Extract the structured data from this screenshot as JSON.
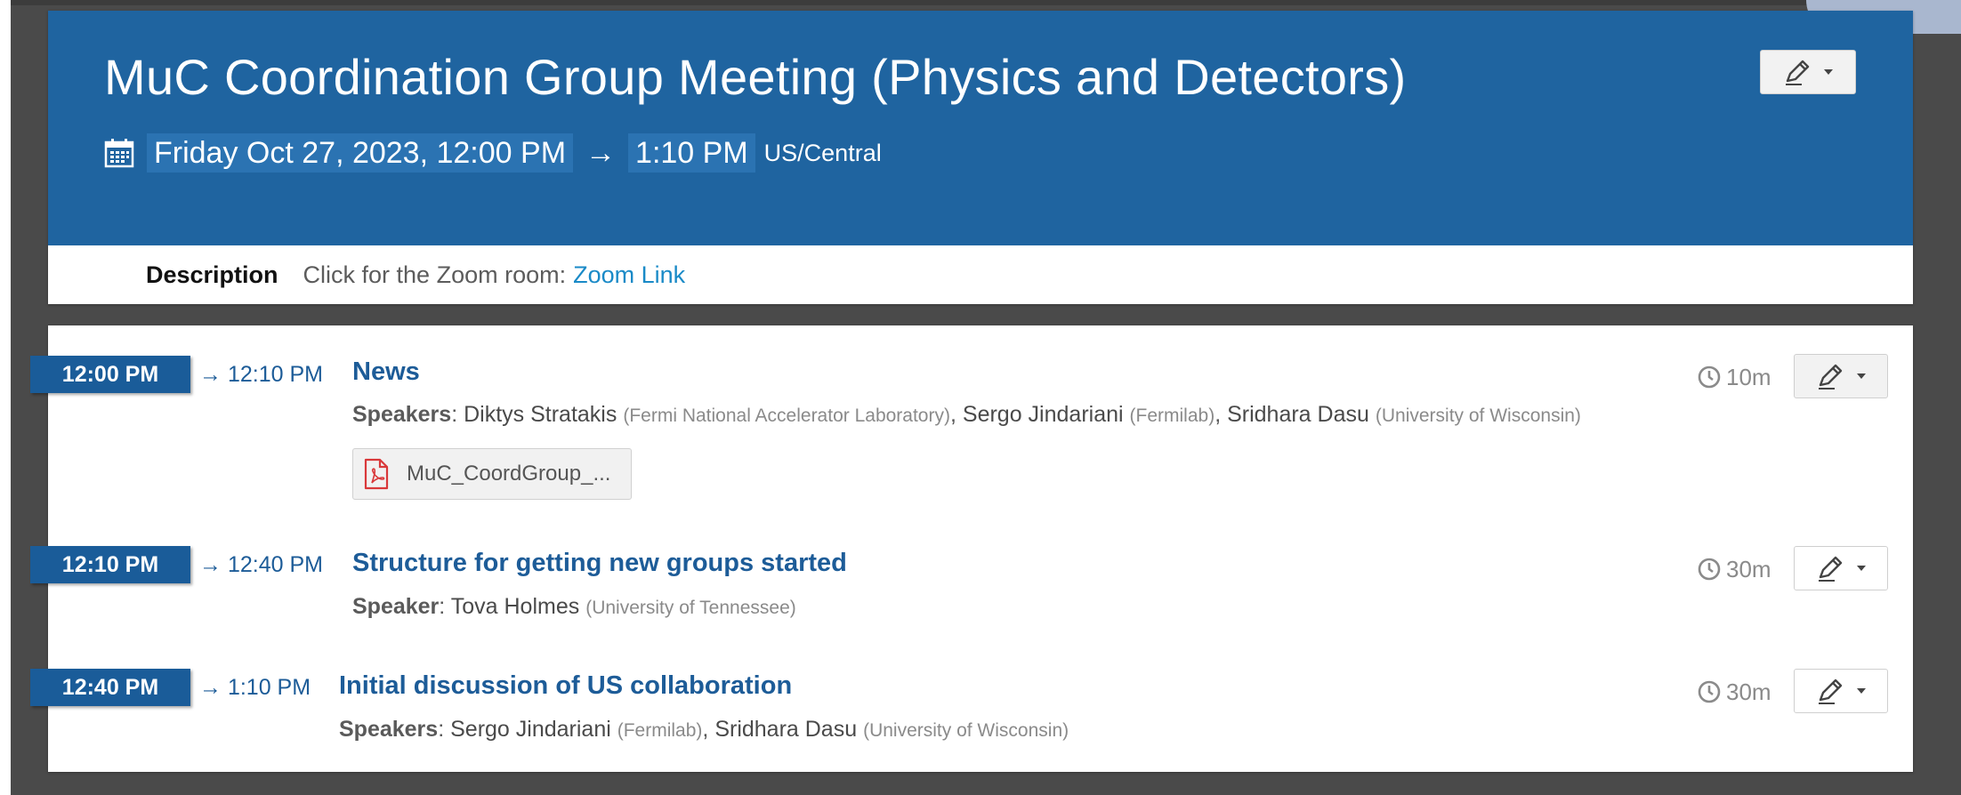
{
  "event": {
    "title": "MuC Coordination Group Meeting (Physics and Detectors)",
    "start": "Friday Oct 27, 2023, 12:00 PM",
    "arrow": "→",
    "end": "1:10 PM",
    "timezone": "US/Central",
    "description_label": "Description",
    "description_text": "Click for the Zoom room:",
    "description_link": "Zoom Link"
  },
  "icons": {
    "calendar": "calendar-icon",
    "edit": "pencil-icon",
    "caret": "caret-down-icon",
    "clock": "clock-icon",
    "pdf": "pdf-file-icon"
  },
  "colors": {
    "header_bg": "#1f64a0",
    "badge_bg": "#1a5c99",
    "title_link": "#1d5c98",
    "zoom_link": "#1a8ac7",
    "pdf_red": "#d9383a"
  },
  "timetable": [
    {
      "start": "12:00 PM",
      "end": "→ 12:10 PM",
      "title": "News",
      "speaker_label": "Speakers",
      "speakers": [
        {
          "name": "Diktys Stratakis",
          "affiliation": "(Fermi National Accelerator Laboratory)"
        },
        {
          "name": "Sergo Jindariani",
          "affiliation": "(Fermilab)"
        },
        {
          "name": "Sridhara Dasu",
          "affiliation": "(University of Wisconsin)"
        }
      ],
      "attachment": "MuC_CoordGroup_...",
      "duration": "10m"
    },
    {
      "start": "12:10 PM",
      "end": "→ 12:40 PM",
      "title": "Structure for getting new groups started",
      "speaker_label": "Speaker",
      "speakers": [
        {
          "name": "Tova Holmes",
          "affiliation": "(University of Tennessee)"
        }
      ],
      "duration": "30m"
    },
    {
      "start": "12:40 PM",
      "end": "→ 1:10 PM",
      "title": "Initial discussion of US collaboration",
      "speaker_label": "Speakers",
      "speakers": [
        {
          "name": "Sergo Jindariani",
          "affiliation": "(Fermilab)"
        },
        {
          "name": "Sridhara Dasu",
          "affiliation": "(University of Wisconsin)"
        }
      ],
      "duration": "30m"
    }
  ]
}
